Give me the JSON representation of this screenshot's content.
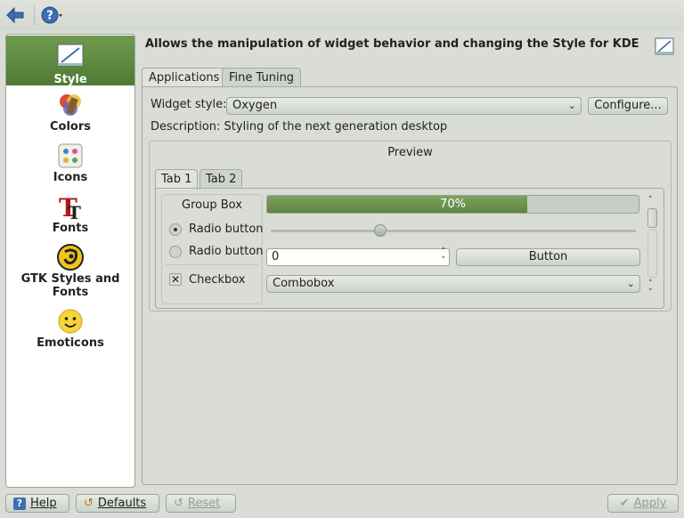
{
  "toolbar": {
    "back_icon": "back-arrow-icon",
    "help_icon": "help-whatsthis-icon"
  },
  "sidebar": {
    "items": [
      {
        "label": "Style",
        "icon": "style-icon",
        "active": true
      },
      {
        "label": "Colors",
        "icon": "colors-icon"
      },
      {
        "label": "Icons",
        "icon": "icons-icon"
      },
      {
        "label": "Fonts",
        "icon": "fonts-icon"
      },
      {
        "label": "GTK Styles and Fonts",
        "icon": "gtk-icon"
      },
      {
        "label": "Emoticons",
        "icon": "emoticons-icon"
      }
    ]
  },
  "header": {
    "title": "Allows the manipulation of widget behavior and changing the Style for KDE"
  },
  "tabs": [
    {
      "label": "Applications"
    },
    {
      "label": "Fine Tuning"
    }
  ],
  "style": {
    "widget_style_label": "Widget style:",
    "widget_style_value": "Oxygen",
    "configure_label": "Configure...",
    "description": "Description: Styling of the next generation desktop"
  },
  "preview": {
    "title": "Preview",
    "tabs": [
      {
        "label": "Tab 1"
      },
      {
        "label": "Tab 2"
      }
    ],
    "group_box_title": "Group Box",
    "radio1": "Radio button",
    "radio2": "Radio button",
    "checkbox": "Checkbox",
    "progress_text": "70%",
    "progress_value": 0.7,
    "slider_value": 0.3,
    "spin_value": "0",
    "button_label": "Button",
    "combobox_value": "Combobox"
  },
  "footer": {
    "help_label": "Help",
    "defaults_label": "Defaults",
    "reset_label": "Reset",
    "apply_label": "Apply"
  },
  "colors": {
    "accent": "#5e8440",
    "background": "#d9ddd6"
  }
}
